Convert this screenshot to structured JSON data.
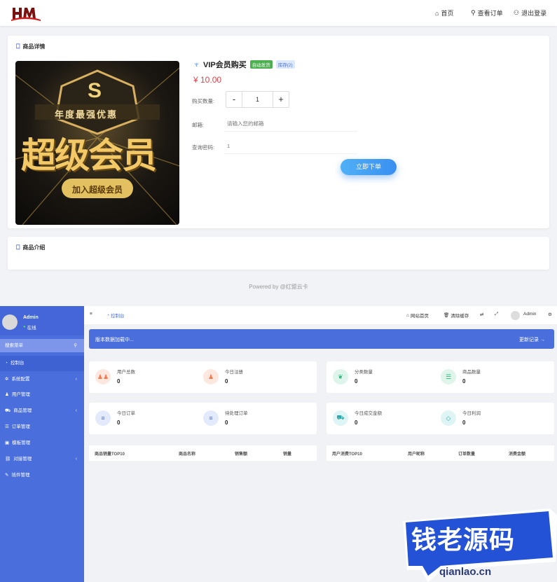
{
  "shop": {
    "logo_text": "HM",
    "nav": [
      {
        "label": "首页",
        "icon": "home-icon"
      },
      {
        "label": "查看订单",
        "icon": "search-icon"
      },
      {
        "label": "退出登录",
        "icon": "user-icon"
      }
    ],
    "detail_title": "商品详情",
    "product": {
      "name": "VIP会员购买",
      "badge_auto": "自动发货",
      "badge_stock": "库存(2)",
      "price": "¥ 10.00",
      "image_text": {
        "top": "年度最强优惠",
        "big": "超级会员",
        "button": "加入超级会员",
        "emblem": "S"
      }
    },
    "form": {
      "qty_label": "购买数量:",
      "qty_minus": "-",
      "qty_value": "1",
      "qty_plus": "+",
      "email_label": "邮箱:",
      "email_placeholder": "请输入您的邮箱",
      "pwd_label": "查询密码:",
      "pwd_value": "1",
      "buy_label": "立即下单"
    },
    "intro_title": "商品介绍",
    "powered": "Powered by @红盟云卡"
  },
  "admin": {
    "user": {
      "name": "Admin",
      "status": "在线"
    },
    "search_placeholder": "搜索菜单",
    "menu": [
      {
        "label": "控制台",
        "icon": "dashboard-icon",
        "arrow": ""
      },
      {
        "label": "系统配置",
        "icon": "gear-icon",
        "arrow": "‹"
      },
      {
        "label": "用户管理",
        "icon": "user-icon",
        "arrow": ""
      },
      {
        "label": "商品管理",
        "icon": "cart-icon",
        "arrow": "‹"
      },
      {
        "label": "订单管理",
        "icon": "list-icon",
        "arrow": ""
      },
      {
        "label": "模板管理",
        "icon": "template-icon",
        "arrow": ""
      },
      {
        "label": "对接管理",
        "icon": "link-icon",
        "arrow": "‹"
      },
      {
        "label": "插件管理",
        "icon": "plugin-icon",
        "arrow": ""
      }
    ],
    "topbar": {
      "breadcrumb": "控制台",
      "home": "网站首页",
      "clear": "清除缓存",
      "user": "Admin"
    },
    "notice": {
      "text": "版本数据加载中...",
      "link": "更新记录 →"
    },
    "stats": [
      {
        "label": "用户总数",
        "value": "0",
        "icon": "users-icon",
        "bg": "#fde8df",
        "fg": "#f07b52"
      },
      {
        "label": "今日注册",
        "value": "0",
        "icon": "user-add-icon",
        "bg": "#fde8df",
        "fg": "#f07b52"
      },
      {
        "label": "分类数量",
        "value": "0",
        "icon": "leaf-icon",
        "bg": "#dff5ec",
        "fg": "#2bb67b"
      },
      {
        "label": "商品数量",
        "value": "0",
        "icon": "list-icon",
        "bg": "#dff5ec",
        "fg": "#2bb67b"
      },
      {
        "label": "今日订单",
        "value": "0",
        "icon": "menu-icon",
        "bg": "#e3eafb",
        "fg": "#4a6fdc"
      },
      {
        "label": "待处理订单",
        "value": "0",
        "icon": "menu-icon",
        "bg": "#e3eafb",
        "fg": "#4a6fdc"
      },
      {
        "label": "今日成交金额",
        "value": "0",
        "icon": "cart-icon",
        "bg": "#dff4f4",
        "fg": "#2aa7a7"
      },
      {
        "label": "今日利润",
        "value": "0",
        "icon": "diamond-icon",
        "bg": "#dff4f4",
        "fg": "#2aa7a7"
      }
    ],
    "table_left": [
      "商品销量TOP10",
      "商品名称",
      "销售额",
      "销量"
    ],
    "table_right": [
      "用户消费TOP10",
      "用户昵称",
      "订单数量",
      "消费金额"
    ]
  },
  "watermark": {
    "text": "钱老源码",
    "url": "qianlao.cn"
  }
}
